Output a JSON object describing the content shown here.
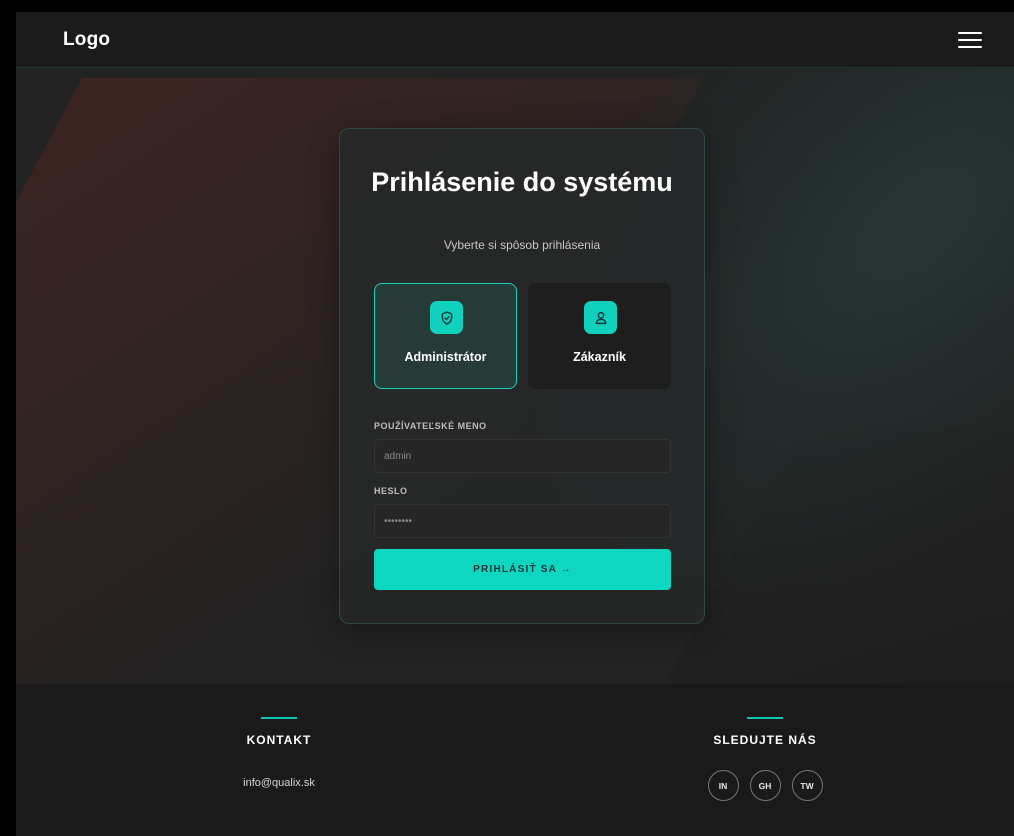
{
  "header": {
    "logo": "Logo",
    "menu_icon": "hamburger-menu-icon"
  },
  "login": {
    "title": "Prihlásenie do systému",
    "subtitle": "Vyberte si spôsob prihlásenia",
    "roles": [
      {
        "label": "Administrátor",
        "icon": "shield-icon",
        "selected": true
      },
      {
        "label": "Zákazník",
        "icon": "user-icon",
        "selected": false
      }
    ],
    "username_label": "POUŽÍVATEĽSKÉ MENO",
    "username_value": "admin",
    "password_label": "HESLO",
    "password_value": "••••••••",
    "submit_label": "PRIHLÁSIŤ SA →"
  },
  "footer": {
    "contact_heading": "KONTAKT",
    "contact_email": "info@qualix.sk",
    "social_heading": "SLEDUJTE NÁS",
    "socials": [
      "IN",
      "GH",
      "TW"
    ]
  },
  "colors": {
    "accent": "#0dd7c0",
    "background": "#232323",
    "header_bg": "#1b1b1b",
    "footer_bg": "#1a1a1a",
    "card_bg": "#262828"
  }
}
